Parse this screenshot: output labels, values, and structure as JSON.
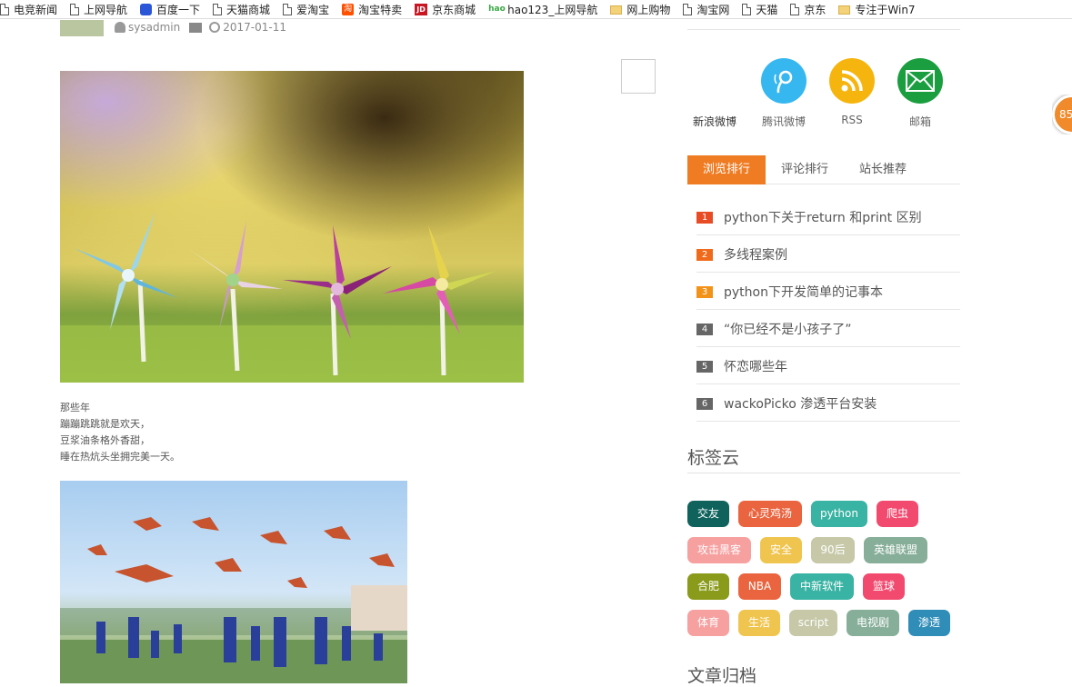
{
  "bookmarks": [
    {
      "label": "电竞新闻",
      "icon": "page-icon"
    },
    {
      "label": "上网导航",
      "icon": "page-icon"
    },
    {
      "label": "百度一下",
      "icon": "baidu-paw-icon"
    },
    {
      "label": "天猫商城",
      "icon": "page-icon"
    },
    {
      "label": "爱淘宝",
      "icon": "page-icon"
    },
    {
      "label": "淘宝特卖",
      "icon": "taobao-icon"
    },
    {
      "label": "京东商城",
      "icon": "jd-icon"
    },
    {
      "label": "hao123_上网导航",
      "icon": "hao123-icon"
    },
    {
      "label": "网上购物",
      "icon": "folder-icon"
    },
    {
      "label": "淘宝网",
      "icon": "page-icon"
    },
    {
      "label": "天猫",
      "icon": "page-icon"
    },
    {
      "label": "京东",
      "icon": "page-icon"
    },
    {
      "label": "专注于Win7",
      "icon": "folder-icon"
    }
  ],
  "post": {
    "author": "sysadmin",
    "date": "2017-01-11",
    "poem": [
      "那些年",
      "蹦蹦跳跳就是欢天，",
      "豆浆油条格外香甜，",
      "睡在热炕头坐拥完美一天。"
    ]
  },
  "social": [
    {
      "label": "新浪微博",
      "color": "#ffffff",
      "icon": "weibo-icon"
    },
    {
      "label": "腾讯微博",
      "color": "#37b7f0",
      "icon": "tencent-weibo-icon"
    },
    {
      "label": "RSS",
      "color": "#f6b50e",
      "icon": "rss-icon"
    },
    {
      "label": "邮箱",
      "color": "#1a9e3f",
      "icon": "mail-icon"
    }
  ],
  "tabs": [
    {
      "label": "浏览排行"
    },
    {
      "label": "评论排行"
    },
    {
      "label": "站长推荐"
    }
  ],
  "ranking": [
    {
      "num": "1",
      "title": "python下关于return 和print 区别",
      "color": "#e84c25"
    },
    {
      "num": "2",
      "title": "多线程案例",
      "color": "#f06a1b"
    },
    {
      "num": "3",
      "title": "python下开发简单的记事本",
      "color": "#f39218"
    },
    {
      "num": "4",
      "title": "“你已经不是小孩子了”",
      "color": "#666666"
    },
    {
      "num": "5",
      "title": "怀恋哪些年",
      "color": "#666666"
    },
    {
      "num": "6",
      "title": "wackoPicko 渗透平台安装",
      "color": "#666666"
    }
  ],
  "tag_cloud": {
    "title": "标签云",
    "tags": [
      {
        "label": "交友",
        "color": "#10635d"
      },
      {
        "label": "心灵鸡汤",
        "color": "#e9643f"
      },
      {
        "label": "python",
        "color": "#39b3a3"
      },
      {
        "label": "爬虫",
        "color": "#f24a6f"
      },
      {
        "label": "攻击黑客",
        "color": "#f7a0a0"
      },
      {
        "label": "安全",
        "color": "#f0c54f"
      },
      {
        "label": "90后",
        "color": "#c6c8a8"
      },
      {
        "label": "英雄联盟",
        "color": "#86ae98"
      },
      {
        "label": "合肥",
        "color": "#8a9a1a"
      },
      {
        "label": "NBA",
        "color": "#e9643f"
      },
      {
        "label": "中新软件",
        "color": "#39b3a3"
      },
      {
        "label": "篮球",
        "color": "#f24a6f"
      },
      {
        "label": "体育",
        "color": "#f7a0a0"
      },
      {
        "label": "生活",
        "color": "#f0c54f"
      },
      {
        "label": "script",
        "color": "#c6c8a8"
      },
      {
        "label": "电视剧",
        "color": "#86ae98"
      },
      {
        "label": "渗透",
        "color": "#2f8db8"
      }
    ]
  },
  "archive": {
    "title": "文章归档"
  },
  "float_badge": {
    "text": "85"
  }
}
